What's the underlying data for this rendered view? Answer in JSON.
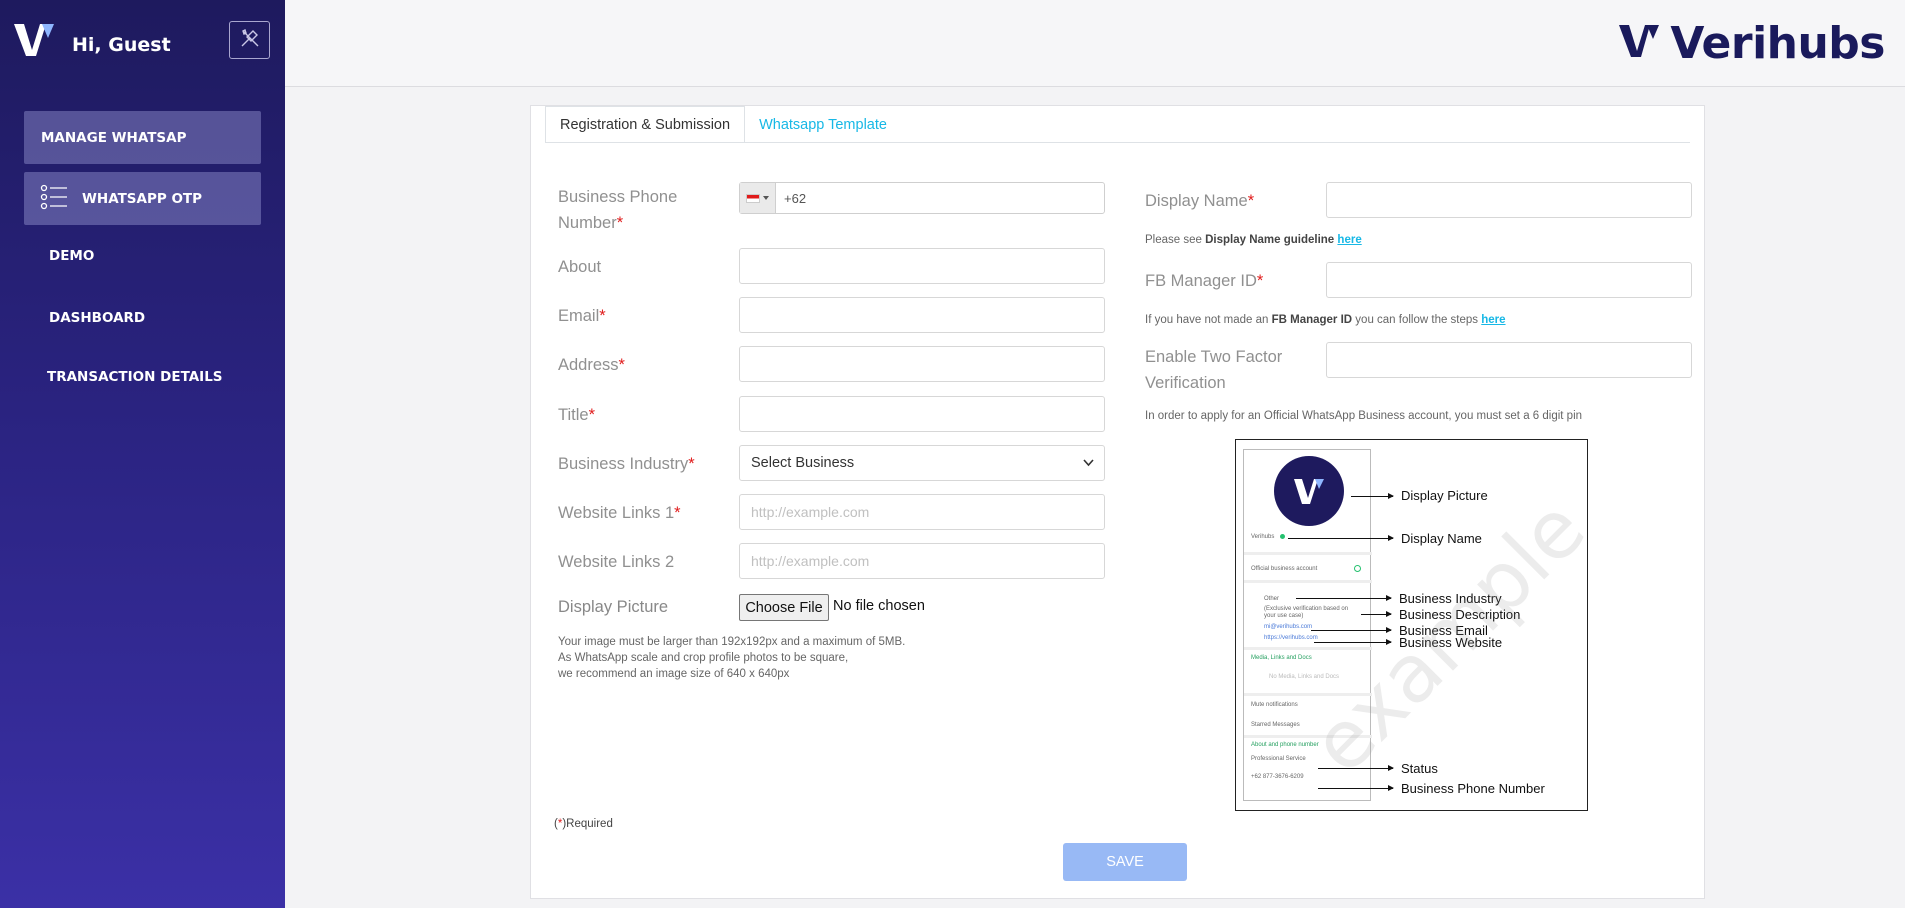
{
  "sidebar": {
    "greeting": "Hi, Guest",
    "items": [
      {
        "label": "MANAGE WHATSAP"
      },
      {
        "label": "WHATSAPP OTP"
      },
      {
        "label": "DEMO"
      },
      {
        "label": "DASHBOARD"
      },
      {
        "label": "TRANSACTION DETAILS"
      }
    ]
  },
  "header": {
    "brand": "Verihubs"
  },
  "tabs": [
    {
      "label": "Registration & Submission",
      "active": true
    },
    {
      "label": "Whatsapp Template",
      "active": false
    }
  ],
  "form": {
    "phone": {
      "label": "Business Phone Number",
      "code": "+62"
    },
    "about": {
      "label": "About",
      "value": ""
    },
    "email": {
      "label": "Email",
      "value": ""
    },
    "address": {
      "label": "Address",
      "value": ""
    },
    "title": {
      "label": "Title",
      "value": ""
    },
    "industry": {
      "label": "Business Industry",
      "selected": "Select Business"
    },
    "website1": {
      "label": "Website Links 1",
      "placeholder": "http://example.com"
    },
    "website2": {
      "label": "Website Links 2",
      "placeholder": "http://example.com"
    },
    "picture": {
      "label": "Display Picture",
      "button": "Choose File",
      "status": "No file chosen",
      "note": [
        "Your image must be larger than 192x192px and a maximum of 5MB.",
        "As WhatsApp scale and crop profile photos to be square,",
        "we recommend an image size of 640 x 640px"
      ]
    },
    "display_name": {
      "label": "Display Name",
      "value": ""
    },
    "display_name_note": {
      "prefix": "Please see ",
      "bold": "Display Name guideline",
      "link": "here"
    },
    "fb_manager": {
      "label": "FB Manager ID",
      "value": ""
    },
    "fb_note": {
      "prefix": "If you have not made an ",
      "bold": "FB Manager ID",
      "middle": " you can follow the steps ",
      "link": "here"
    },
    "two_factor": {
      "label": "Enable Two Factor Verification",
      "value": ""
    },
    "two_factor_note": "In order to apply for an Official WhatsApp Business account, you must set a 6 digit pin",
    "required_note": "Required",
    "required_mark": "*",
    "save": "SAVE"
  },
  "example": {
    "watermark": "example",
    "annotations": [
      "Display Picture",
      "Display Name",
      "Business Industry",
      "Business Description",
      "Business Email",
      "Business Website",
      "Status",
      "Business Phone Number"
    ],
    "mock": {
      "name": "Verihubs",
      "official": "Official business account",
      "industry": "Other",
      "description": "(Exclusive verification based on your use case)",
      "email": "mi@verihubs.com",
      "website": "https://verihubs.com",
      "media": "Media, Links and Docs",
      "no_media": "No Media, Links and Docs",
      "mute": "Mute notifications",
      "starred": "Starred Messages",
      "about_phone": "About and phone number",
      "status": "Professional Service",
      "phone": "+62 877-3676-6209"
    }
  },
  "colors": {
    "accent": "#17b8e6",
    "sidebar_top": "#1e1a5e",
    "sidebar_bottom": "#3b30a6",
    "save": "#98b9f5",
    "required": "#e01b1b"
  }
}
